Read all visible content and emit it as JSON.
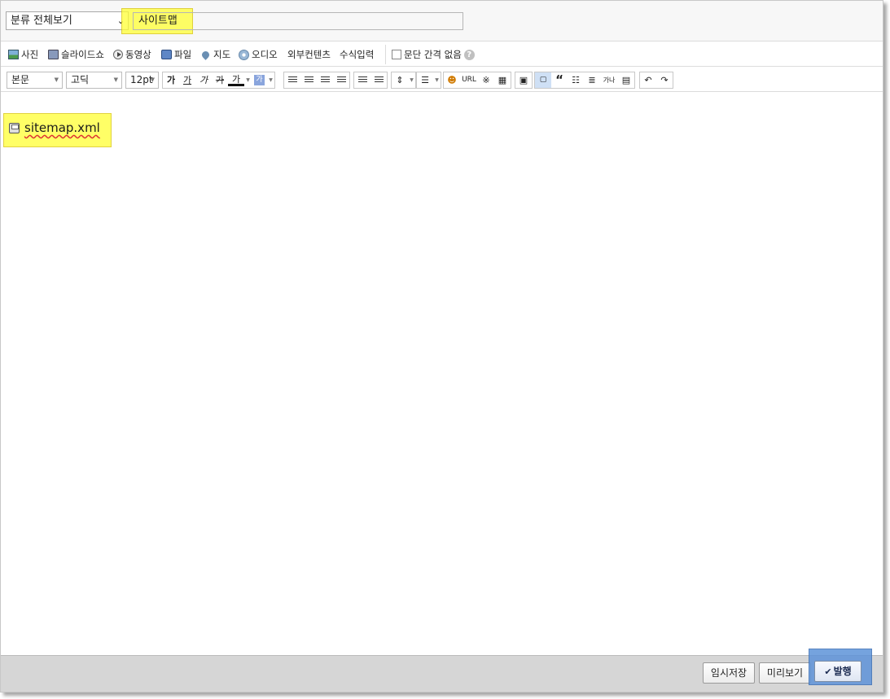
{
  "title_row": {
    "category_select": "분류 전체보기",
    "title_value": "사이트맵"
  },
  "attach_bar": {
    "items": [
      {
        "label": "사진",
        "icon": "photo-icon"
      },
      {
        "label": "슬라이드쇼",
        "icon": "slideshow-icon"
      },
      {
        "label": "동영상",
        "icon": "video-icon"
      },
      {
        "label": "파일",
        "icon": "file-icon"
      },
      {
        "label": "지도",
        "icon": "map-pin-icon"
      },
      {
        "label": "오디오",
        "icon": "audio-icon"
      },
      {
        "label": "외부컨텐츠",
        "icon": ""
      },
      {
        "label": "수식입력",
        "icon": ""
      }
    ],
    "no_paragraph_spacing": "문단 간격 없음",
    "help": "?"
  },
  "format_bar": {
    "paragraph_style": "본문",
    "font_family": "고딕",
    "font_size": "12pt",
    "bold": "가",
    "underline": "가",
    "italic": "가",
    "strike": "가",
    "font_color": "가",
    "bg_color": "가",
    "url": "URL",
    "reference": "※",
    "quote": "“",
    "sup": "가나"
  },
  "editor": {
    "attachment_name": "sitemap.xml"
  },
  "footer": {
    "save_draft": "임시저장",
    "preview": "미리보기",
    "publish": "발행"
  },
  "colors": {
    "highlight": "#ffff33",
    "publish_highlight": "#5e93d9",
    "bottom_bar": "#d6d6d6"
  }
}
